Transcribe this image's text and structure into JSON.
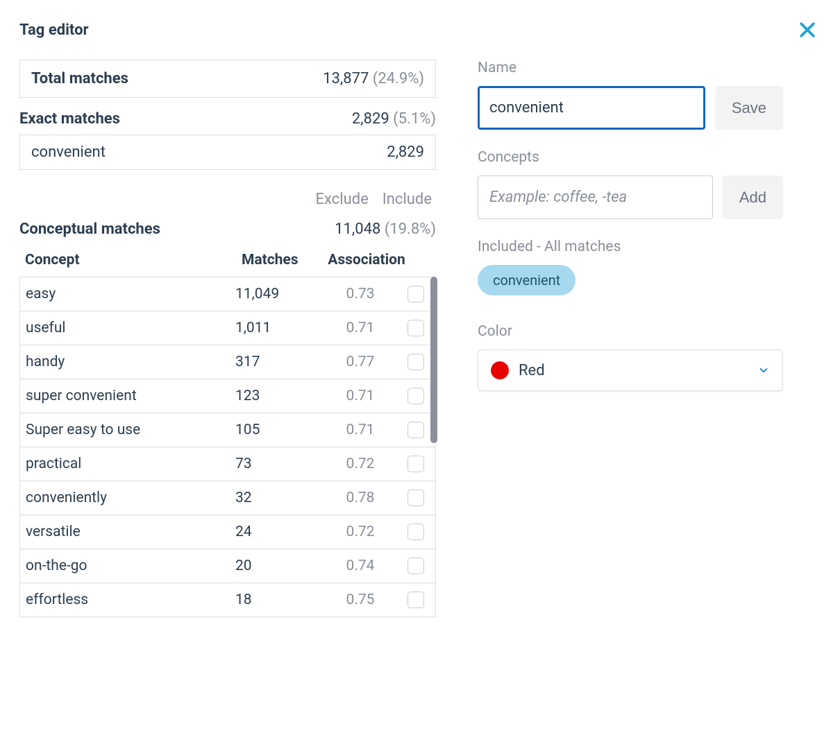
{
  "title": "Tag editor",
  "left": {
    "total": {
      "label": "Total matches",
      "value": "13,877",
      "pct": "(24.9%)"
    },
    "exact": {
      "label": "Exact matches",
      "value": "2,829",
      "pct": "(5.1%)"
    },
    "exact_items": [
      {
        "term": "convenient",
        "count": "2,829"
      }
    ],
    "exclude_label": "Exclude",
    "include_label": "Include",
    "conceptual": {
      "label": "Conceptual matches",
      "value": "11,048",
      "pct": "(19.8%)"
    },
    "headers": {
      "concept": "Concept",
      "matches": "Matches",
      "association": "Association"
    },
    "concepts": [
      {
        "name": "easy",
        "matches": "11,049",
        "assoc": "0.73"
      },
      {
        "name": "useful",
        "matches": "1,011",
        "assoc": "0.71"
      },
      {
        "name": "handy",
        "matches": "317",
        "assoc": "0.77"
      },
      {
        "name": "super convenient",
        "matches": "123",
        "assoc": "0.71"
      },
      {
        "name": "Super easy to use",
        "matches": "105",
        "assoc": "0.71"
      },
      {
        "name": "practical",
        "matches": "73",
        "assoc": "0.72"
      },
      {
        "name": "conveniently",
        "matches": "32",
        "assoc": "0.78"
      },
      {
        "name": "versatile",
        "matches": "24",
        "assoc": "0.72"
      },
      {
        "name": "on-the-go",
        "matches": "20",
        "assoc": "0.74"
      },
      {
        "name": "effortless",
        "matches": "18",
        "assoc": "0.75"
      }
    ]
  },
  "right": {
    "name_label": "Name",
    "name_value": "convenient",
    "save_label": "Save",
    "concepts_label": "Concepts",
    "concepts_placeholder": "Example: coffee, -tea",
    "add_label": "Add",
    "included_label": "Included - All matches",
    "chips": [
      "convenient"
    ],
    "color_label": "Color",
    "color_name": "Red",
    "color_hex": "#e60000"
  }
}
